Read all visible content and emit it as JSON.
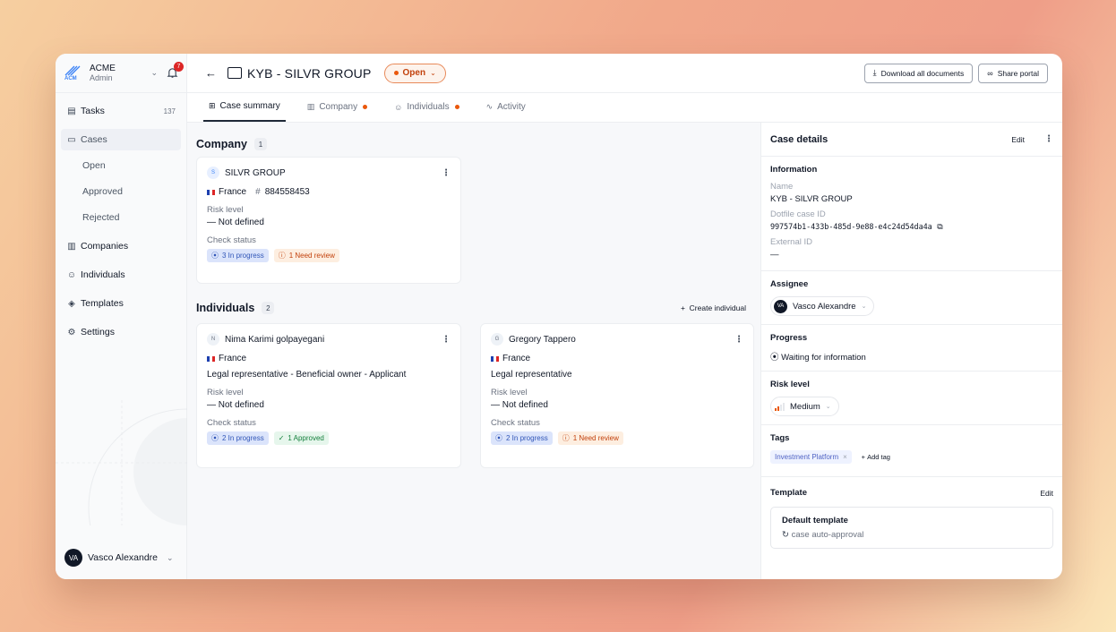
{
  "workspace": {
    "logo_text": "ACM",
    "name": "ACME",
    "role": "Admin",
    "notifications": "7"
  },
  "sidebar": {
    "items": [
      {
        "label": "Tasks",
        "icon": "clipboard-icon",
        "count": "137"
      },
      {
        "label": "Cases",
        "icon": "folder-icon"
      },
      {
        "label": "Companies",
        "icon": "building-icon"
      },
      {
        "label": "Individuals",
        "icon": "users-icon"
      },
      {
        "label": "Templates",
        "icon": "layers-icon"
      },
      {
        "label": "Settings",
        "icon": "gear-icon"
      }
    ],
    "case_subitems": [
      "Open",
      "Approved",
      "Rejected"
    ],
    "user": {
      "initials": "VA",
      "name": "Vasco Alexandre"
    }
  },
  "header": {
    "title": "KYB - SILVR GROUP",
    "status": "Open",
    "download_label": "Download all documents",
    "share_label": "Share portal"
  },
  "tabs": [
    {
      "label": "Case summary"
    },
    {
      "label": "Company"
    },
    {
      "label": "Individuals"
    },
    {
      "label": "Activity"
    }
  ],
  "company_section": {
    "title": "Company",
    "count": "1",
    "card": {
      "initial": "S",
      "name": "SILVR GROUP",
      "country": "France",
      "registration": "884558453",
      "risk_label": "Risk level",
      "risk_value": "— Not defined",
      "check_label": "Check status",
      "chips": [
        "3 In progress",
        "1 Need review"
      ]
    }
  },
  "individuals_section": {
    "title": "Individuals",
    "count": "2",
    "create_label": "Create individual",
    "cards": [
      {
        "initial": "N",
        "name": "Nima Karimi golpayegani",
        "country": "France",
        "roles": "Legal representative - Beneficial owner - Applicant",
        "risk_label": "Risk level",
        "risk_value": "— Not defined",
        "check_label": "Check status",
        "chips": [
          "2 In progress",
          "1 Approved"
        ]
      },
      {
        "initial": "G",
        "name": "Gregory Tappero",
        "country": "France",
        "roles": "Legal representative",
        "risk_label": "Risk level",
        "risk_value": "— Not defined",
        "check_label": "Check status",
        "chips": [
          "2 In progress",
          "1 Need review"
        ]
      }
    ]
  },
  "case_details": {
    "title": "Case details",
    "edit_label": "Edit",
    "information": {
      "title": "Information",
      "name_label": "Name",
      "name_value": "KYB - SILVR GROUP",
      "id_label": "Dotfile case ID",
      "id_value": "997574b1-433b-485d-9e88-e4c24d54da4a",
      "external_label": "External ID",
      "external_value": "—"
    },
    "assignee": {
      "title": "Assignee",
      "initials": "VA",
      "name": "Vasco Alexandre"
    },
    "progress": {
      "title": "Progress",
      "value": "Waiting for information"
    },
    "risk": {
      "title": "Risk level",
      "value": "Medium",
      "level": 2,
      "max": 4
    },
    "tags": {
      "title": "Tags",
      "items": [
        "Investment Platform"
      ],
      "add_label": "Add tag"
    },
    "template": {
      "title": "Template",
      "edit_label": "Edit",
      "name": "Default template",
      "subtitle": "case auto-approval"
    }
  },
  "colors": {
    "accent_orange": "#ea580c",
    "chip_blue": "#3156b8",
    "chip_green": "#15803d"
  }
}
